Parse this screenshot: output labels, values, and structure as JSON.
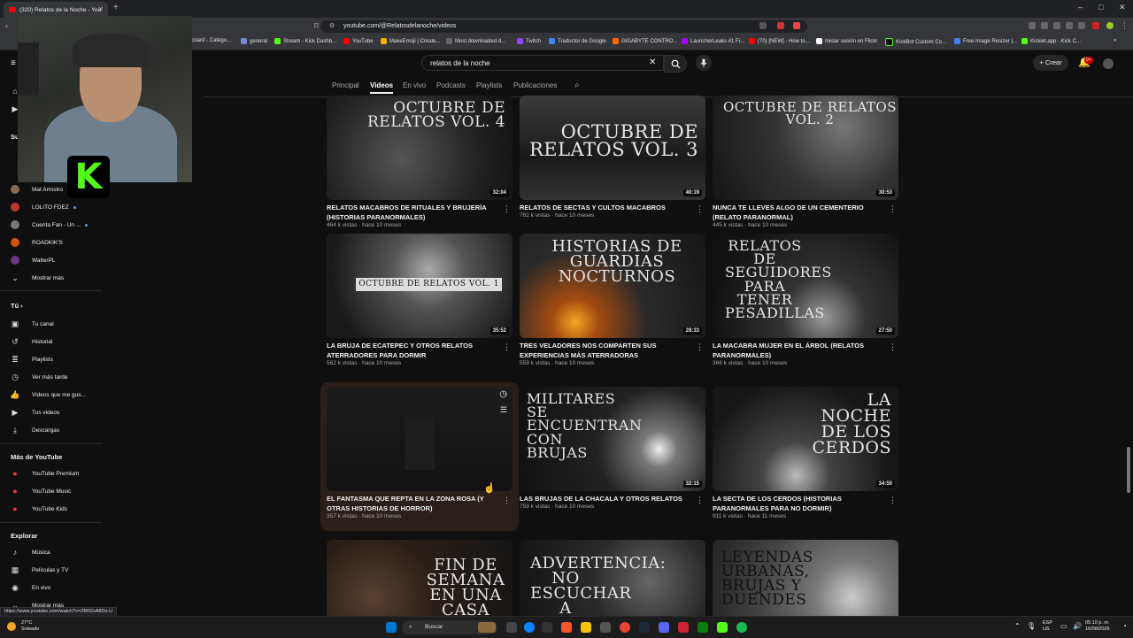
{
  "browser": {
    "tab_title": "(320) Relatos de la Noche - YouTube",
    "url": "youtube.com/@Relatosdelanoche/videos",
    "bookmarks": [
      "board - Catego...",
      "general",
      "Stream - Kick Dashb...",
      "YouTube",
      "MakeEmoji | Create...",
      "Most downloaded d...",
      "Twitch",
      "Traductor de Google",
      "GIGABYTE CONTRO...",
      "LauncherLeaks #1 Fi...",
      "(70) [NEW] - How to...",
      "Iniciar sesión en Flickr",
      "KickBot Custom Co...",
      "Free Image Resizer |...",
      "Kickiet.app - Kick C..."
    ],
    "status_url": "https://www.youtube.com/watch?v=ZBR2xA8Ds-U"
  },
  "header": {
    "search_value": "relatos de la noche",
    "create_label": "Crear",
    "notif_badge": "9+"
  },
  "channel_tabs": [
    "Principal",
    "Videos",
    "En vivo",
    "Podcasts",
    "Playlists",
    "Publicaciones"
  ],
  "sidebar": {
    "subs_header": "Su",
    "subscriptions": [
      {
        "name": "Mat Armstro",
        "color": "#8a6d4f"
      },
      {
        "name": "LOLITO FDEZ",
        "color": "#c0392b",
        "live": true
      },
      {
        "name": "Cuenta Fan - Un ...",
        "color": "#777777",
        "live": true
      },
      {
        "name": "ROADKIK'S",
        "color": "#d35400"
      },
      {
        "name": "WalterPL",
        "color": "#6c3483"
      }
    ],
    "show_more": "Mostrar más",
    "you_header": "Tú",
    "you_items": [
      "Tu canal",
      "Historial",
      "Playlists",
      "Ver más tarde",
      "Videos que me gus...",
      "Tus videos",
      "Descargas"
    ],
    "more_header": "Más de YouTube",
    "more_items": [
      "YouTube Premium",
      "YouTube Music",
      "YouTube Kids"
    ],
    "explore_header": "Explorar",
    "explore_items": [
      "Música",
      "Películas y TV",
      "En vivo",
      "Mostrar más"
    ]
  },
  "videos": [
    {
      "title": "RELATOS MACABROS DE RITUALES Y BRUJERÍA (HISTORIAS PARANORMALES)",
      "meta": "464 k vistas · hace 10 meses",
      "duration": "32:04",
      "thumb_text": "OCTUBRE DE RELATOS VOL. 4",
      "two_lines": true
    },
    {
      "title": "RELATOS DE SECTAS Y CULTOS MACABROS",
      "meta": "782 k vistas · hace 10 meses",
      "duration": "40:19",
      "thumb_text": "OCTUBRE DE RELATOS VOL. 3",
      "two_lines": false
    },
    {
      "title": "NUNCA TE LLEVES ALGO DE UN CEMENTERIO (RELATO PARANORMAL)",
      "meta": "445 k vistas · hace 10 meses",
      "duration": "30:53",
      "thumb_text": "OCTUBRE DE RELATOS VOL. 2",
      "two_lines": true
    },
    {
      "title": "LA BRUJA DE ECATEPEC Y OTROS RELATOS ATERRADORES PARA DORMIR",
      "meta": "562 k vistas · hace 10 meses",
      "duration": "35:52",
      "thumb_text": "OCTUBRE DE RELATOS VOL. 1",
      "two_lines": true
    },
    {
      "title": "TRES VELADORES NOS COMPARTEN SUS EXPERIENCIAS MÁS ATERRADORAS",
      "meta": "559 k vistas · hace 10 meses",
      "duration": "28:33",
      "thumb_text": "HISTORIAS DE GUARDIAS NOCTURNOS",
      "two_lines": true
    },
    {
      "title": "LA MACABRA MUJER EN EL ÁRBOL (RELATOS PARANORMALES)",
      "meta": "366 k vistas · hace 10 meses",
      "duration": "27:50",
      "thumb_text": "RELATOS DE SEGUIDORES PARA TENER PESADILLAS",
      "two_lines": true
    },
    {
      "title": "EL FANTASMA QUE REPTA EN LA ZONA ROSA (Y OTRAS HISTORIAS DE HORROR)",
      "meta": "357 k vistas · hace 10 meses",
      "duration": "",
      "thumb_text": "",
      "two_lines": true
    },
    {
      "title": "LAS BRUJAS DE LA CHACALA Y OTROS RELATOS",
      "meta": "759 k vistas · hace 10 meses",
      "duration": "32:15",
      "thumb_text": "MILITARES SE ENCUENTRAN CON BRUJAS",
      "two_lines": false
    },
    {
      "title": "LA SECTA DE LOS CERDOS (HISTORIAS PARANORMALES PARA NO DORMIR)",
      "meta": "911 k vistas · hace 11 meses",
      "duration": "34:50",
      "thumb_text": "LA NOCHE DE LOS CERDOS",
      "two_lines": true
    },
    {
      "title": "",
      "meta": "",
      "duration": "",
      "thumb_text": "FIN DE SEMANA EN UNA CASA",
      "two_lines": false
    },
    {
      "title": "",
      "meta": "",
      "duration": "",
      "thumb_text": "ADVERTENCIA: NO ESCUCHAR A SOLAS",
      "two_lines": false
    },
    {
      "title": "",
      "meta": "",
      "duration": "",
      "thumb_text": "LEYENDAS URBANAS, BRUJAS Y DUENDES",
      "two_lines": false
    }
  ],
  "taskbar": {
    "weather_temp": "27°C",
    "weather_desc": "Soleado",
    "search_label": "Buscar",
    "lang": "ESP",
    "region": "US",
    "time": "05:10 p. m.",
    "date": "16/08/2026"
  }
}
